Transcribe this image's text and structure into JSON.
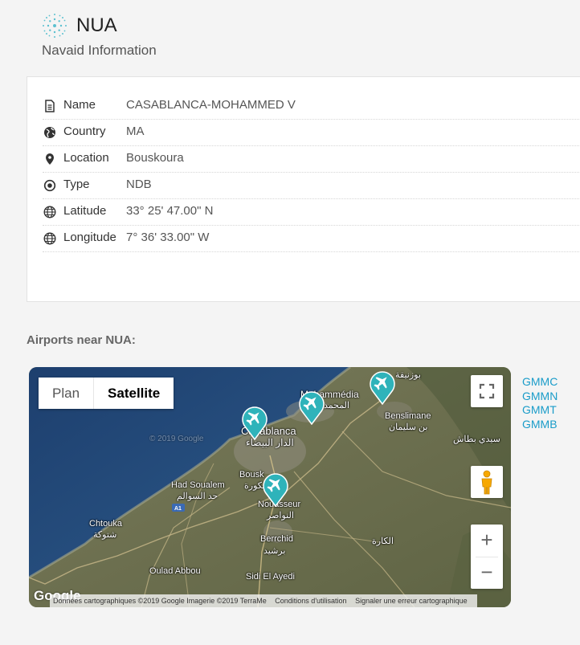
{
  "header": {
    "code": "NUA",
    "subtitle": "Navaid Information"
  },
  "details": [
    {
      "icon": "document-icon",
      "label": "Name",
      "value": "CASABLANCA-MOHAMMED V"
    },
    {
      "icon": "globe-filled-icon",
      "label": "Country",
      "value": "MA"
    },
    {
      "icon": "map-pin-icon",
      "label": "Location",
      "value": "Bouskoura"
    },
    {
      "icon": "target-icon",
      "label": "Type",
      "value": "NDB"
    },
    {
      "icon": "globe-grid-icon",
      "label": "Latitude",
      "value": "33° 25' 47.00\" N"
    },
    {
      "icon": "globe-grid-icon",
      "label": "Longitude",
      "value": "7° 36' 33.00\" W"
    }
  ],
  "nearby": {
    "title": "Airports near NUA:",
    "airports": [
      "GMMC",
      "GMMN",
      "GMMT",
      "GMMB"
    ]
  },
  "map": {
    "maptype_plan": "Plan",
    "maptype_satellite": "Satellite",
    "zoom_in": "+",
    "zoom_out": "−",
    "logo": "Google",
    "watermark": "© 2019 Google",
    "labels": {
      "casablanca": "Casablanca",
      "casablanca_ar": "الدار البيضاء",
      "mohammedia": "Mohammédia",
      "mohammedia_ar": "المحمدية",
      "benslimane": "Benslimane",
      "benslimane_ar": "بن سليمان",
      "bouznika_ar": "بوزنيقة",
      "sidi_bettache_ar": "سيدي بطاش",
      "had_soualem": "Had Soualem",
      "had_soualem_ar": "حد السوالم",
      "bouskoura": "Bousk",
      "bouskoura_ar": "بوسكورة",
      "nouaceur": "Nouasseur",
      "nouaceur_ar": "النواصر",
      "chtouka": "Chtouka",
      "chtouka_ar": "شتوكة",
      "berrchid": "Berrchid",
      "berrchid_ar": "برشيد",
      "kara_ar": "الكارة",
      "oulad_abbou": "Oulad Abbou",
      "sidi_el_ayedi": "Sidi El Ayedi",
      "a1": "A1"
    },
    "attribution": {
      "data": "Données cartographiques ©2019 Google Imagerie ©2019 TerraMe",
      "terms": "Conditions d'utilisation",
      "report": "Signaler une erreur cartographique"
    },
    "colors": {
      "pin": "#2fb3ba",
      "link": "#1a9cc9"
    }
  }
}
